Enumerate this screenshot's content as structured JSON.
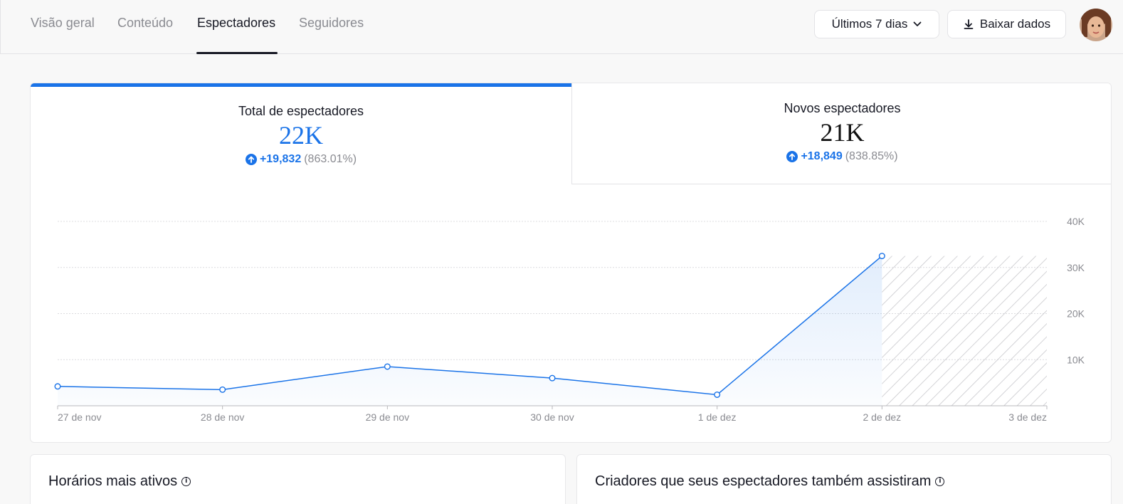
{
  "nav": {
    "tabs": [
      {
        "label": "Visão geral",
        "active": false
      },
      {
        "label": "Conteúdo",
        "active": false
      },
      {
        "label": "Espectadores",
        "active": true
      },
      {
        "label": "Seguidores",
        "active": false
      }
    ],
    "date_range": "Últimos 7 dias",
    "download_label": "Baixar dados"
  },
  "metrics": [
    {
      "label": "Total de espectadores",
      "value": "22K",
      "delta": "+19,832",
      "pct": "(863.01%)",
      "active": true
    },
    {
      "label": "Novos espectadores",
      "value": "21K",
      "delta": "+18,849",
      "pct": "(838.85%)",
      "active": false
    }
  ],
  "chart_data": {
    "type": "area",
    "x": [
      "27 de nov",
      "28 de nov",
      "29 de nov",
      "30 de nov",
      "1 de dez",
      "2 de dez",
      "3 de dez"
    ],
    "y_ticks": [
      "40K",
      "30K",
      "20K",
      "10K"
    ],
    "ylim": [
      0,
      40000
    ],
    "series": [
      {
        "values": [
          4200,
          3500,
          8500,
          6000,
          2400,
          32500,
          null
        ]
      }
    ],
    "hatched_region": [
      "2 de dez",
      "3 de dez"
    ],
    "grid": true,
    "color": "#1a73e8"
  },
  "sections": {
    "active_hours": "Horários mais ativos",
    "creators": "Criadores que seus espectadores também assistiram"
  },
  "colors": {
    "accent": "#1a73e8",
    "text": "#161823",
    "muted": "#8a8b91"
  }
}
